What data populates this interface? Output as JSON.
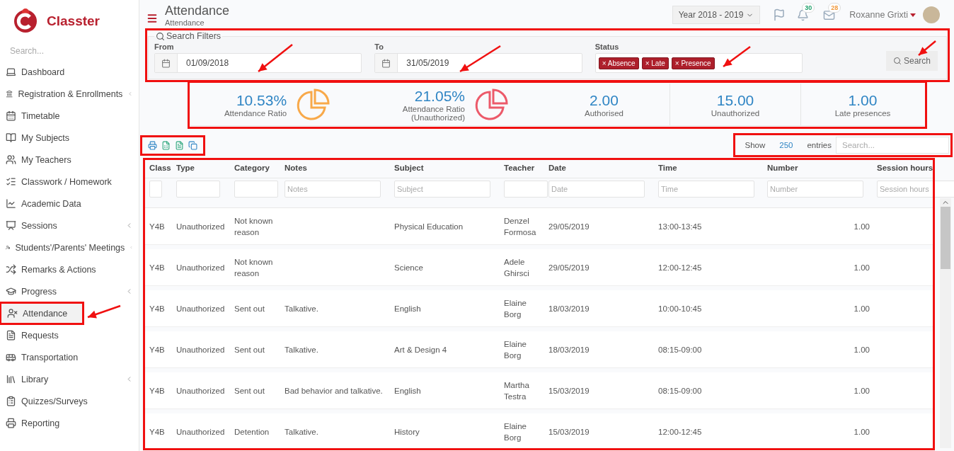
{
  "brand": {
    "name": "Classter"
  },
  "sidebar": {
    "search_placeholder": "Search...",
    "items": [
      {
        "label": "Dashboard",
        "expandable": false,
        "selected": false
      },
      {
        "label": "Registration & Enrollments",
        "expandable": true,
        "selected": false
      },
      {
        "label": "Timetable",
        "expandable": false,
        "selected": false
      },
      {
        "label": "My Subjects",
        "expandable": false,
        "selected": false
      },
      {
        "label": "My Teachers",
        "expandable": false,
        "selected": false
      },
      {
        "label": "Classwork / Homework",
        "expandable": false,
        "selected": false
      },
      {
        "label": "Academic Data",
        "expandable": false,
        "selected": false
      },
      {
        "label": "Sessions",
        "expandable": true,
        "selected": false
      },
      {
        "label": "Students'/Parents' Meetings",
        "expandable": true,
        "selected": false
      },
      {
        "label": "Remarks & Actions",
        "expandable": false,
        "selected": false
      },
      {
        "label": "Progress",
        "expandable": true,
        "selected": false
      },
      {
        "label": "Attendance",
        "expandable": false,
        "selected": true
      },
      {
        "label": "Requests",
        "expandable": false,
        "selected": false
      },
      {
        "label": "Transportation",
        "expandable": false,
        "selected": false
      },
      {
        "label": "Library",
        "expandable": true,
        "selected": false
      },
      {
        "label": "Quizzes/Surveys",
        "expandable": false,
        "selected": false
      },
      {
        "label": "Reporting",
        "expandable": false,
        "selected": false
      }
    ]
  },
  "header": {
    "title": "Attendance",
    "breadcrumb": "Attendance",
    "year": "Year 2018 - 2019",
    "notifications": "30",
    "messages": "28",
    "user": "Roxanne Grixti"
  },
  "filters": {
    "legend": "Search Filters",
    "from": {
      "label": "From",
      "value": "01/09/2018"
    },
    "to": {
      "label": "To",
      "value": "31/05/2019"
    },
    "status": {
      "label": "Status",
      "remove_glyph": "×",
      "tags": [
        "Absence",
        "Late",
        "Presence"
      ]
    },
    "search_button": "Search"
  },
  "stats": [
    {
      "kind": "ratio",
      "value": "10.53%",
      "label": "Attendance Ratio",
      "color": "#f8a94a"
    },
    {
      "kind": "ratio",
      "value": "21.05%",
      "label": "Attendance Ratio (Unauthorized)",
      "color": "#ec5a6a"
    },
    {
      "kind": "count",
      "value": "2.00",
      "label": "Authorised"
    },
    {
      "kind": "count",
      "value": "15.00",
      "label": "Unauthorized"
    },
    {
      "kind": "count",
      "value": "1.00",
      "label": "Late presences"
    }
  ],
  "table": {
    "show_label": "Show",
    "page_size": "250",
    "entries_label": "entries",
    "search_placeholder": "Search...",
    "columns": [
      {
        "label": "Class"
      },
      {
        "label": "Type"
      },
      {
        "label": "Category"
      },
      {
        "label": "Notes",
        "placeholder": "Notes"
      },
      {
        "label": "Subject",
        "placeholder": "Subject"
      },
      {
        "label": "Teacher"
      },
      {
        "label": "Date",
        "placeholder": "Date"
      },
      {
        "label": "Time",
        "placeholder": "Time"
      },
      {
        "label": "Number",
        "placeholder": "Number"
      },
      {
        "label": "Session hours",
        "placeholder": "Session hours"
      }
    ],
    "rows": [
      [
        "Y4B",
        "Unauthorized",
        "Not known reason",
        "",
        "Physical Education",
        "Denzel Formosa",
        "29/05/2019",
        "13:00-13:45",
        "1.00",
        ""
      ],
      [
        "Y4B",
        "Unauthorized",
        "Not known reason",
        "",
        "Science",
        "Adele Ghirsci",
        "29/05/2019",
        "12:00-12:45",
        "1.00",
        ""
      ],
      [
        "Y4B",
        "Unauthorized",
        "Sent out",
        "Talkative.",
        "English",
        "Elaine Borg",
        "18/03/2019",
        "10:00-10:45",
        "1.00",
        ""
      ],
      [
        "Y4B",
        "Unauthorized",
        "Sent out",
        "Talkative.",
        "Art & Design 4",
        "Elaine Borg",
        "18/03/2019",
        "08:15-09:00",
        "1.00",
        ""
      ],
      [
        "Y4B",
        "Unauthorized",
        "Sent out",
        "Bad behavior and talkative.",
        "English",
        "Martha Testra",
        "15/03/2019",
        "08:15-09:00",
        "1.00",
        ""
      ],
      [
        "Y4B",
        "Unauthorized",
        "Detention",
        "Talkative.",
        "History",
        "Elaine Borg",
        "15/03/2019",
        "12:00-12:45",
        "1.00",
        ""
      ]
    ]
  }
}
